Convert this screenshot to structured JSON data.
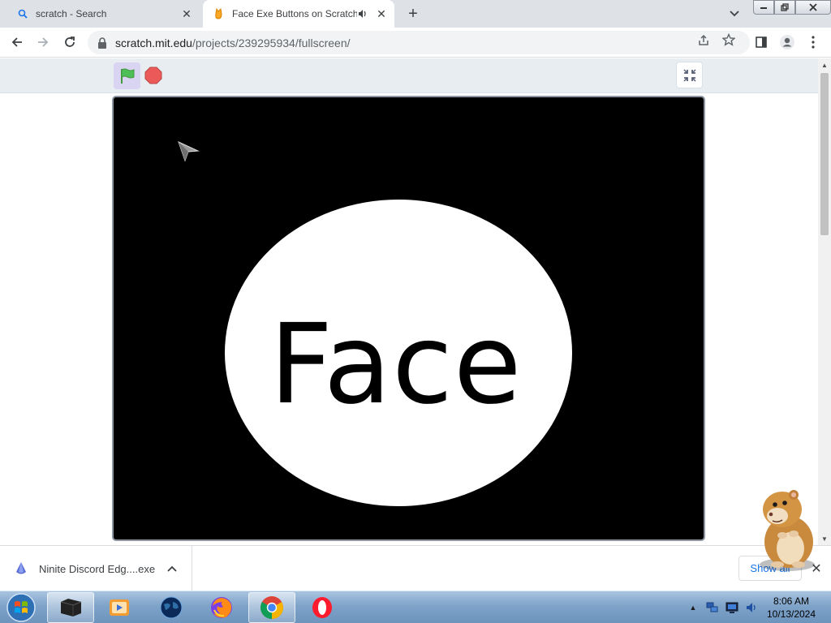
{
  "browser": {
    "tabs": [
      {
        "title": "scratch - Search",
        "favicon": "search-icon",
        "active": false
      },
      {
        "title": "Face Exe Buttons on Scratch",
        "favicon": "scratch-cat-icon",
        "active": true,
        "audio": true
      }
    ],
    "url": {
      "host": "scratch.mit.edu",
      "path": "/projects/239295934/fullscreen/"
    }
  },
  "stage": {
    "text": "Face",
    "background_color": "#000000",
    "ellipse_color": "#ffffff"
  },
  "controls": {
    "green_flag": "green-flag-icon",
    "stop": "stop-icon",
    "exit_fullscreen": "exit-fullscreen-icon"
  },
  "download_bar": {
    "filename": "Ninite Discord Edg....exe",
    "show_all_label": "Show all"
  },
  "taskbar": {
    "apps": [
      "file-explorer-icon",
      "media-player-icon",
      "globe-icon",
      "firefox-icon",
      "chrome-icon",
      "opera-icon"
    ],
    "active_app": "chrome-icon",
    "time": "8:06 AM",
    "date": "10/13/2024"
  },
  "colors": {
    "tabstrip": "#dee1e6",
    "scratch_controlbar": "#e8edf1",
    "flag_green": "#4cbf56",
    "stop_red": "#ec5959",
    "link_blue": "#1a73e8"
  }
}
